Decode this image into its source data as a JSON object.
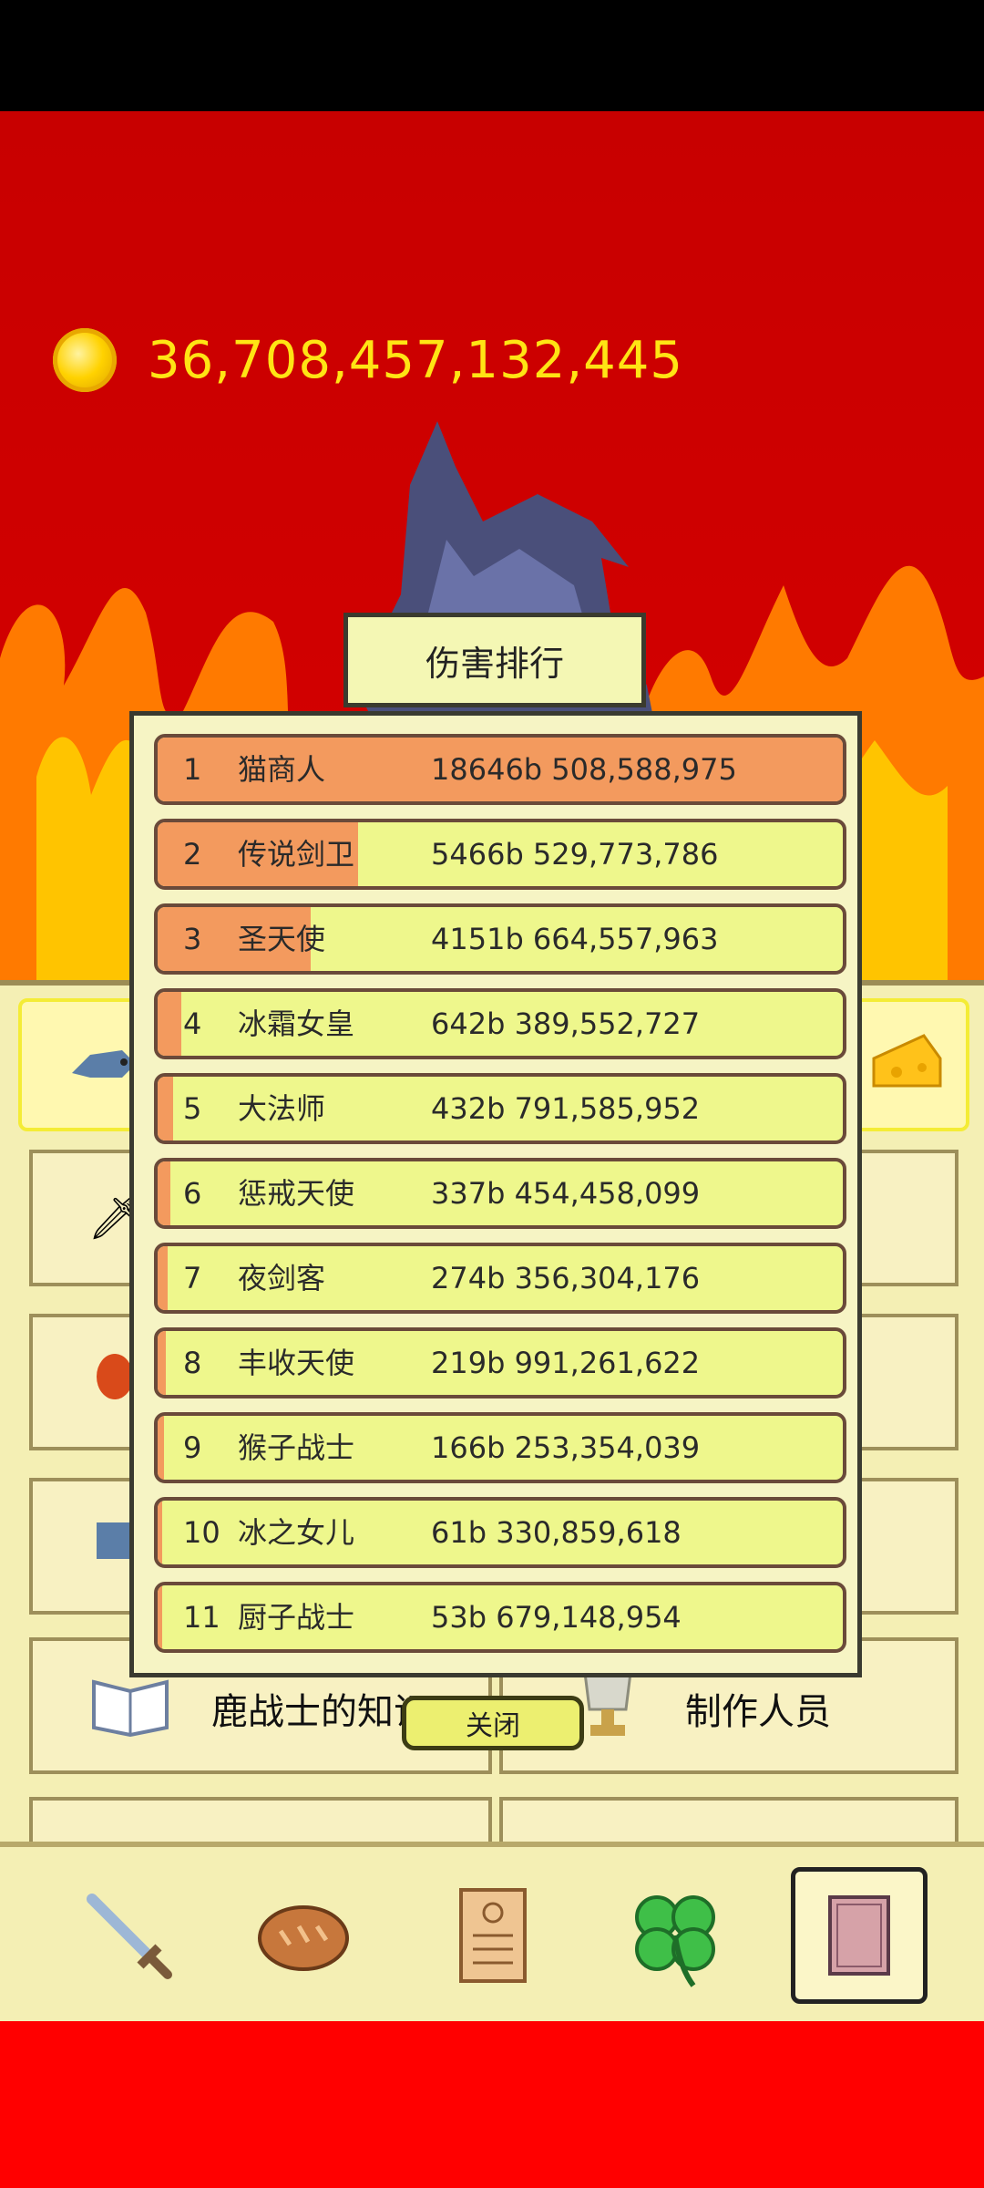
{
  "currency": {
    "amount": "36,708,457,132,445",
    "icon": "gold-coin-icon"
  },
  "dialog": {
    "title": "伤害排行",
    "close_label": "关闭",
    "ranking": [
      {
        "rank": "1",
        "name": "猫商人",
        "damage": "18646b 508,588,975",
        "share": 1.0
      },
      {
        "rank": "2",
        "name": "传说剑卫",
        "damage": "5466b 529,773,786",
        "share": 0.293
      },
      {
        "rank": "3",
        "name": "圣天使",
        "damage": "4151b 664,557,963",
        "share": 0.223
      },
      {
        "rank": "4",
        "name": "冰霜女皇",
        "damage": "642b 389,552,727",
        "share": 0.034
      },
      {
        "rank": "5",
        "name": "大法师",
        "damage": "432b 791,585,952",
        "share": 0.023
      },
      {
        "rank": "6",
        "name": "惩戒天使",
        "damage": "337b 454,458,099",
        "share": 0.018
      },
      {
        "rank": "7",
        "name": "夜剑客",
        "damage": "274b 356,304,176",
        "share": 0.015
      },
      {
        "rank": "8",
        "name": "丰收天使",
        "damage": "219b 991,261,622",
        "share": 0.012
      },
      {
        "rank": "9",
        "name": "猴子战士",
        "damage": "166b 253,354,039",
        "share": 0.009
      },
      {
        "rank": "10",
        "name": "冰之女儿",
        "damage": "61b 330,859,618",
        "share": 0.003
      },
      {
        "rank": "11",
        "name": "厨子战士",
        "damage": "53b 679,148,954",
        "share": 0.003
      }
    ]
  },
  "background_menu": {
    "knowledge_label": "鹿战士的知识",
    "credits_label": "制作人员"
  },
  "bottom_nav": [
    {
      "name": "sword-icon"
    },
    {
      "name": "bread-icon"
    },
    {
      "name": "scroll-icon"
    },
    {
      "name": "clover-icon"
    },
    {
      "name": "book-icon"
    }
  ],
  "colors": {
    "background_red": "#d40000",
    "row_base": "#eef78c",
    "row_fill": "#f39a5e",
    "currency_text": "#ffe414"
  }
}
